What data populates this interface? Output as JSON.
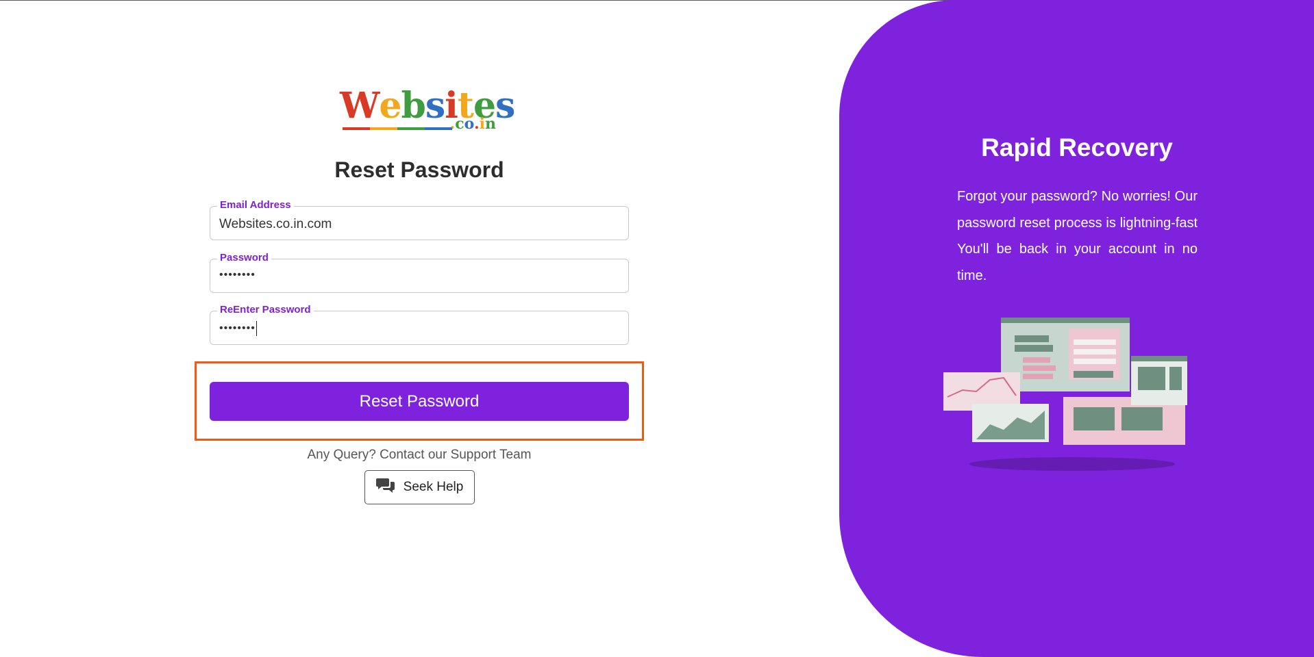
{
  "brand": {
    "name_letters": [
      "W",
      "e",
      "b",
      "s",
      "i",
      "t",
      "e",
      "s"
    ],
    "name_colors": [
      "#d93a25",
      "#f2a81d",
      "#3f9d3f",
      "#2f6fc4",
      "#d93a25",
      "#f2a81d",
      "#3f9d3f",
      "#2f6fc4"
    ],
    "domain": ".co.in",
    "bar_colors": [
      "#d93a25",
      "#f2a81d",
      "#3f9d3f",
      "#2f6fc4"
    ]
  },
  "form": {
    "title": "Reset Password",
    "email": {
      "label": "Email Address",
      "value": "Websites.co.in.com"
    },
    "password": {
      "label": "Password",
      "value": "••••••••"
    },
    "reenter": {
      "label": "ReEnter Password",
      "value": "••••••••"
    },
    "submit_label": "Reset Password"
  },
  "support": {
    "query_text": "Any Query? Contact our Support Team",
    "help_label": "Seek Help",
    "help_icon": "chat-bubbles-icon"
  },
  "promo": {
    "title": "Rapid Recovery",
    "text": "Forgot your password? No worries! Our password reset process is lightning-fast You'll be back in your account in no time.",
    "illustration": "dashboard-illustration"
  },
  "colors": {
    "accent": "#7e22dd",
    "label": "#7e22ce",
    "highlight": "#f05a12"
  }
}
